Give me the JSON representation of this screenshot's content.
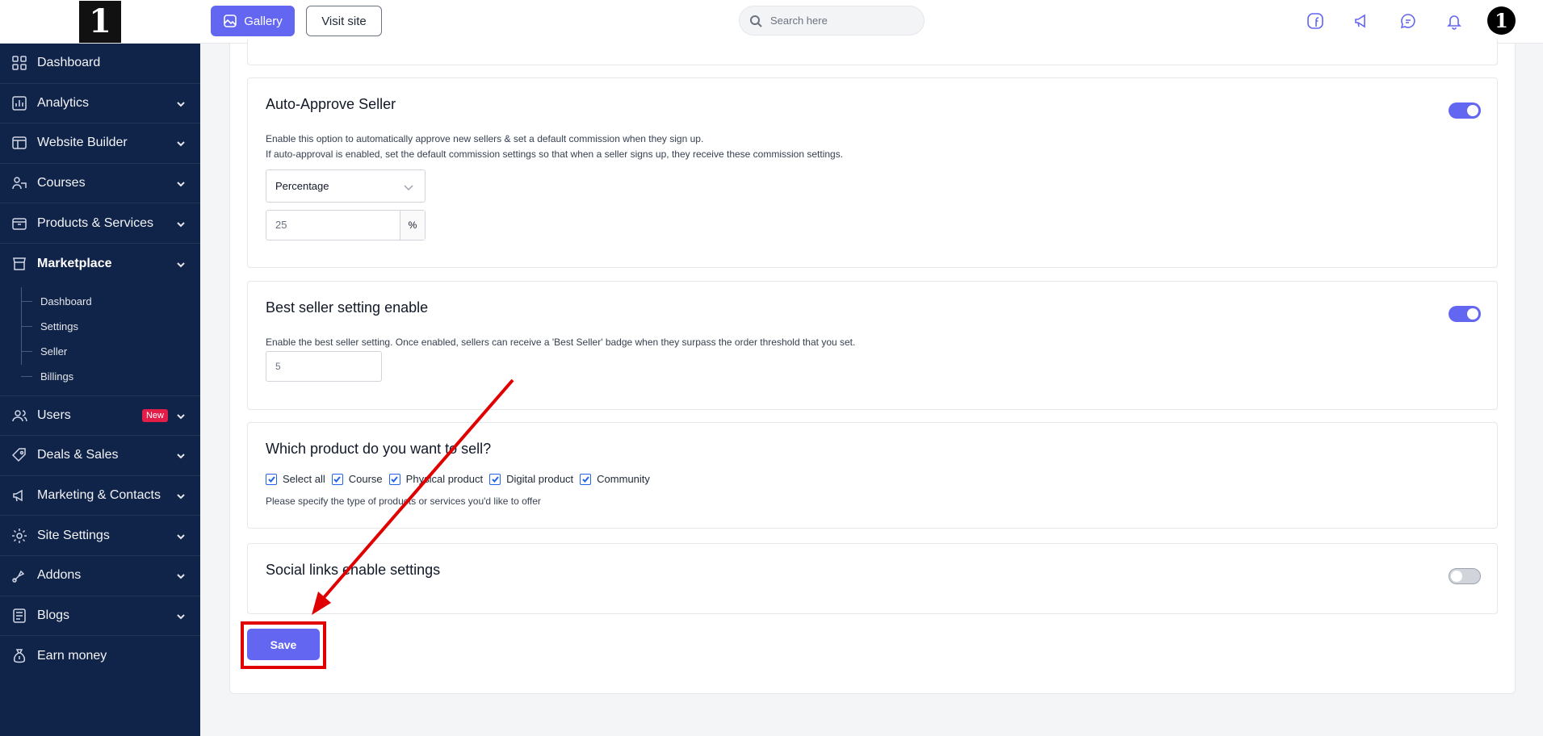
{
  "sidebar": {
    "logo_text": "1",
    "items": [
      {
        "label": "Dashboard",
        "icon": "dashboard-icon"
      },
      {
        "label": "Analytics",
        "icon": "analytics-icon"
      },
      {
        "label": "Website Builder",
        "icon": "website-builder-icon"
      },
      {
        "label": "Courses",
        "icon": "courses-icon"
      },
      {
        "label": "Products & Services",
        "icon": "products-icon"
      },
      {
        "label": "Marketplace",
        "icon": "marketplace-icon"
      },
      {
        "label": "Users",
        "icon": "users-icon",
        "badge": "New"
      },
      {
        "label": "Deals & Sales",
        "icon": "deals-icon"
      },
      {
        "label": "Marketing & Contacts",
        "icon": "marketing-icon"
      },
      {
        "label": "Site Settings",
        "icon": "settings-icon"
      },
      {
        "label": "Addons",
        "icon": "addons-icon"
      },
      {
        "label": "Blogs",
        "icon": "blogs-icon"
      },
      {
        "label": "Earn money",
        "icon": "earn-money-icon"
      }
    ],
    "marketplace_sub": [
      "Dashboard",
      "Settings",
      "Seller",
      "Billings"
    ]
  },
  "header": {
    "gallery_label": "Gallery",
    "visit_site_label": "Visit site",
    "search_placeholder": "Search here",
    "avatar_text": "1"
  },
  "sections": {
    "auto_approve": {
      "title": "Auto-Approve Seller",
      "desc1": "Enable this option to automatically approve new sellers & set a default commission when they sign up.",
      "desc2": "If auto-approval is enabled, set the default commission settings so that when a seller signs up, they receive these commission settings.",
      "enabled": true,
      "commission_type": "Percentage",
      "commission_value": "25",
      "commission_unit": "%"
    },
    "best_seller": {
      "title": "Best seller setting enable",
      "desc": "Enable the best seller setting. Once enabled, sellers can receive a 'Best Seller' badge when they surpass the order threshold that you set.",
      "enabled": true,
      "threshold": "5"
    },
    "products": {
      "title": "Which product do you want to sell?",
      "options": [
        "Select all",
        "Course",
        "Physical product",
        "Digital product",
        "Community"
      ],
      "desc": "Please specify the type of products or services you'd like to offer"
    },
    "social": {
      "title": "Social links enable settings",
      "enabled": false
    }
  },
  "save_label": "Save",
  "colors": {
    "sidebar_bg": "#102349",
    "accent": "#6366f1",
    "annotation": "#e00000"
  }
}
